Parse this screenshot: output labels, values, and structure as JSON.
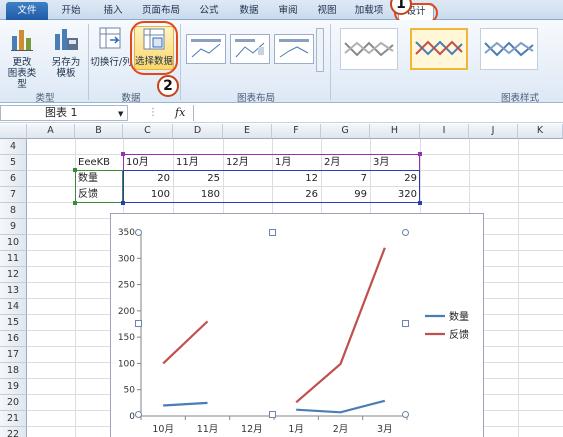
{
  "ribbon": {
    "tabs": [
      "文件",
      "开始",
      "插入",
      "页面布局",
      "公式",
      "数据",
      "审阅",
      "视图",
      "加载项",
      "设计"
    ],
    "buttons": {
      "change_type": "更改\n图表类型",
      "save_template": "另存为\n模板",
      "switch_row_col": "切换行/列",
      "select_data": "选择数据"
    },
    "groups": {
      "type": "类型",
      "data": "数据",
      "layout": "图表布局",
      "styles": "图表样式"
    },
    "badges": [
      "1",
      "2"
    ]
  },
  "formula_bar": {
    "name_box": "图表 1",
    "fx": "fx"
  },
  "sheet": {
    "columns": [
      "A",
      "B",
      "C",
      "D",
      "E",
      "F",
      "G",
      "H",
      "I",
      "J",
      "K"
    ],
    "rows": [
      "4",
      "5",
      "6",
      "7",
      "8",
      "9",
      "10",
      "11",
      "12",
      "13",
      "14",
      "15",
      "16",
      "17",
      "18",
      "19",
      "20",
      "21",
      "22"
    ],
    "cells": {
      "B5": "EeeKB",
      "C5": "10月",
      "D5": "11月",
      "E5": "12月",
      "F5": "1月",
      "G5": "2月",
      "H5": "3月",
      "B6": "数量",
      "C6": "20",
      "D6": "25",
      "F6": "12",
      "G6": "7",
      "H6": "29",
      "B7": "反馈",
      "C7": "100",
      "D7": "180",
      "F7": "26",
      "G7": "99",
      "H7": "320"
    }
  },
  "chart_data": {
    "type": "line",
    "categories": [
      "10月",
      "11月",
      "12月",
      "1月",
      "2月",
      "3月"
    ],
    "series": [
      {
        "name": "数量",
        "values": [
          20,
          25,
          null,
          12,
          7,
          29
        ],
        "color": "#4a7db5"
      },
      {
        "name": "反馈",
        "values": [
          100,
          180,
          null,
          26,
          99,
          320
        ],
        "color": "#c0504d"
      }
    ],
    "y_ticks": [
      0,
      50,
      100,
      150,
      200,
      250,
      300,
      350
    ],
    "ylim": [
      0,
      350
    ],
    "legend": "right",
    "grid": false
  }
}
